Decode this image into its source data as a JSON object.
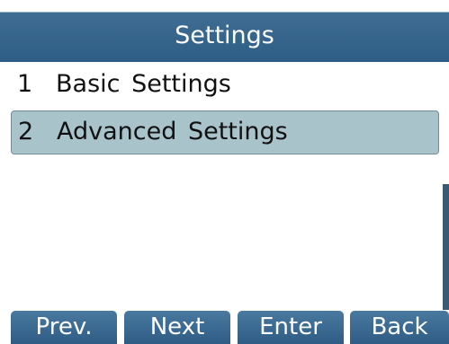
{
  "header": {
    "title": "Settings"
  },
  "menu": {
    "items": [
      {
        "index": "1",
        "label": "Basic Settings"
      },
      {
        "index": "2",
        "label": "Advanced Settings"
      }
    ],
    "selected_index": "2"
  },
  "softkeys": {
    "prev": "Prev.",
    "next": "Next",
    "enter": "Enter",
    "back": "Back"
  },
  "colors": {
    "header_bg": "#2e5d85",
    "selection_bg": "#a9c3cb",
    "softkey_bg": "#3a6890"
  }
}
